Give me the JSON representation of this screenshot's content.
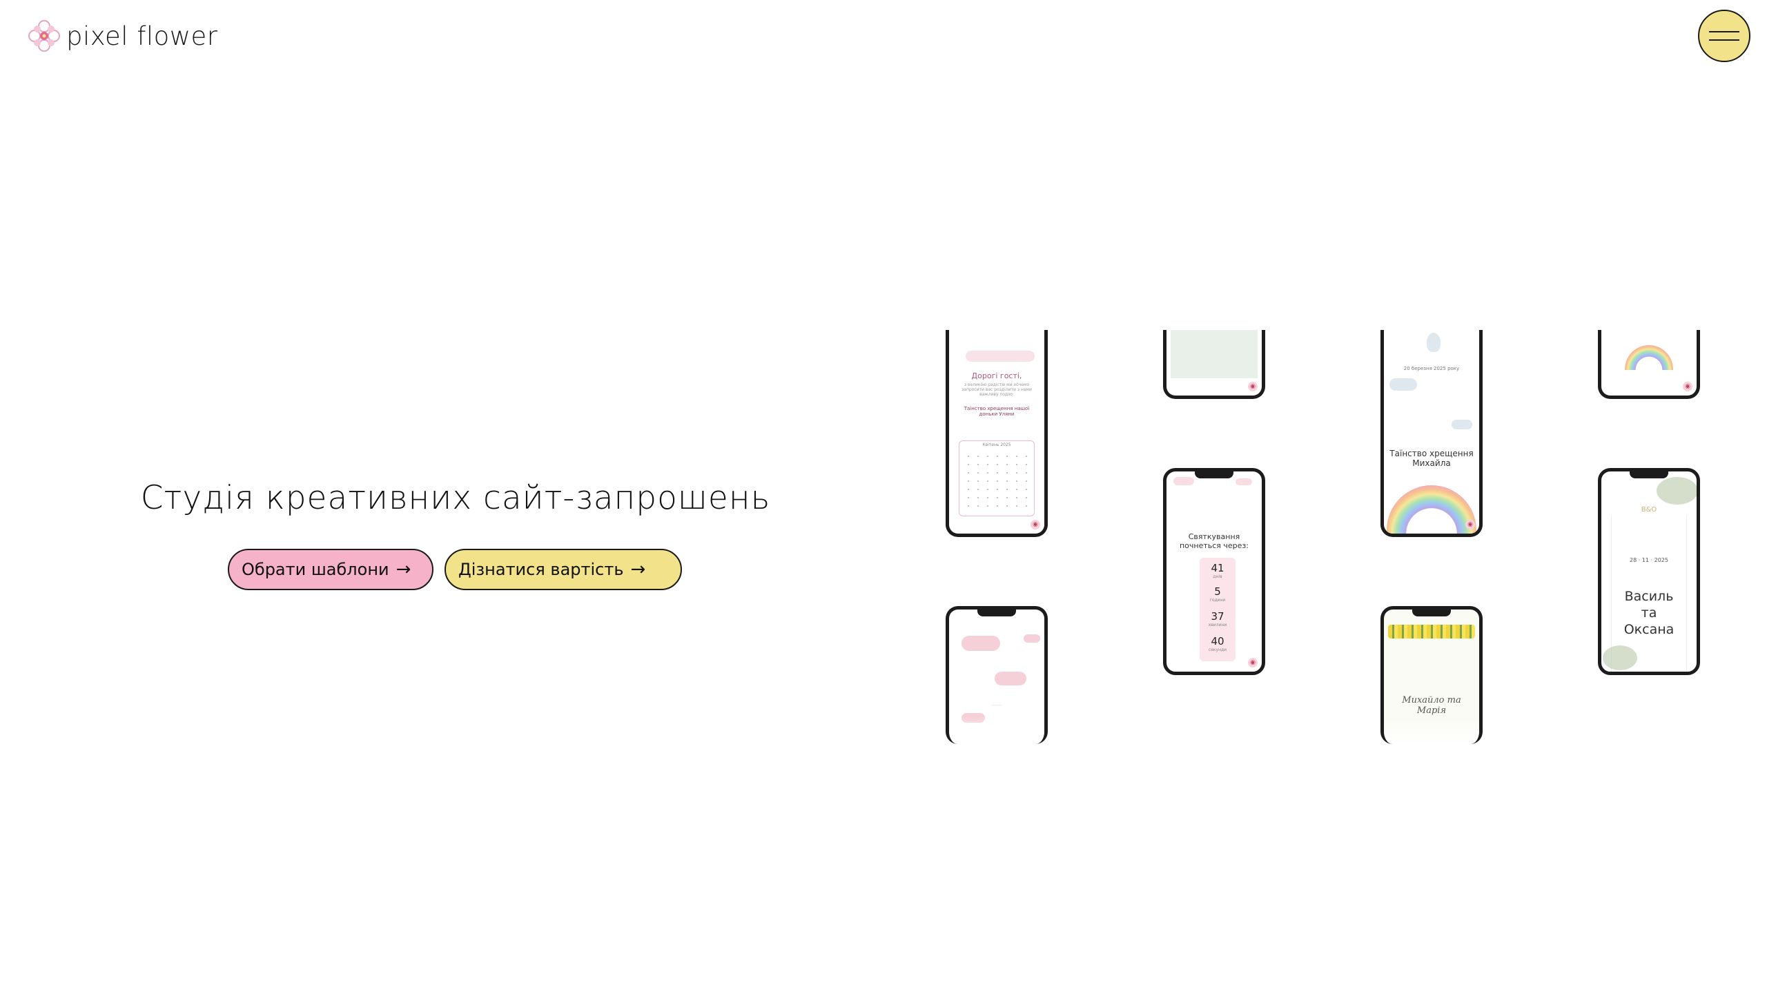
{
  "header": {
    "logo_text": "pixel flower",
    "menu_icon": "hamburger-icon"
  },
  "hero": {
    "title": "Студія креативних сайт-запрошень",
    "buttons": [
      {
        "label": "Обрати шаблони",
        "icon": "arrow-right-icon"
      },
      {
        "label": "Дізнатися вартість",
        "icon": "arrow-right-icon"
      }
    ]
  },
  "colors": {
    "accent_yellow": "#f2e28a",
    "accent_pink": "#f5b2c8",
    "text": "#111111"
  },
  "phones": {
    "p1": {
      "heading": "Дорогі гості,",
      "body": "з великою радістю ми хочемо запросити вас розділити з нами важливу подію:",
      "event": "Таїнство хрещення нашої доньки Уляни",
      "calendar_month": "Квітень 2025",
      "weekdays": "Пн Вт Ср Чт Пт Сб Нд"
    },
    "p3": {
      "date": "20 березня 2025 року",
      "title": "Таїнство хрещення Михайла"
    },
    "p6": {
      "title": "Святкування почнеться через:",
      "counters": [
        {
          "value": "41",
          "unit": "днів"
        },
        {
          "value": "5",
          "unit": "години"
        },
        {
          "value": "37",
          "unit": "хвилини"
        },
        {
          "value": "40",
          "unit": "секунди"
        }
      ]
    },
    "p8": {
      "monogram": "В&О",
      "date": "28 · 11 · 2025",
      "name1": "Василь",
      "conj": "та",
      "name2": "Оксана"
    },
    "p10": {
      "names": "Михайло та Марія"
    }
  }
}
